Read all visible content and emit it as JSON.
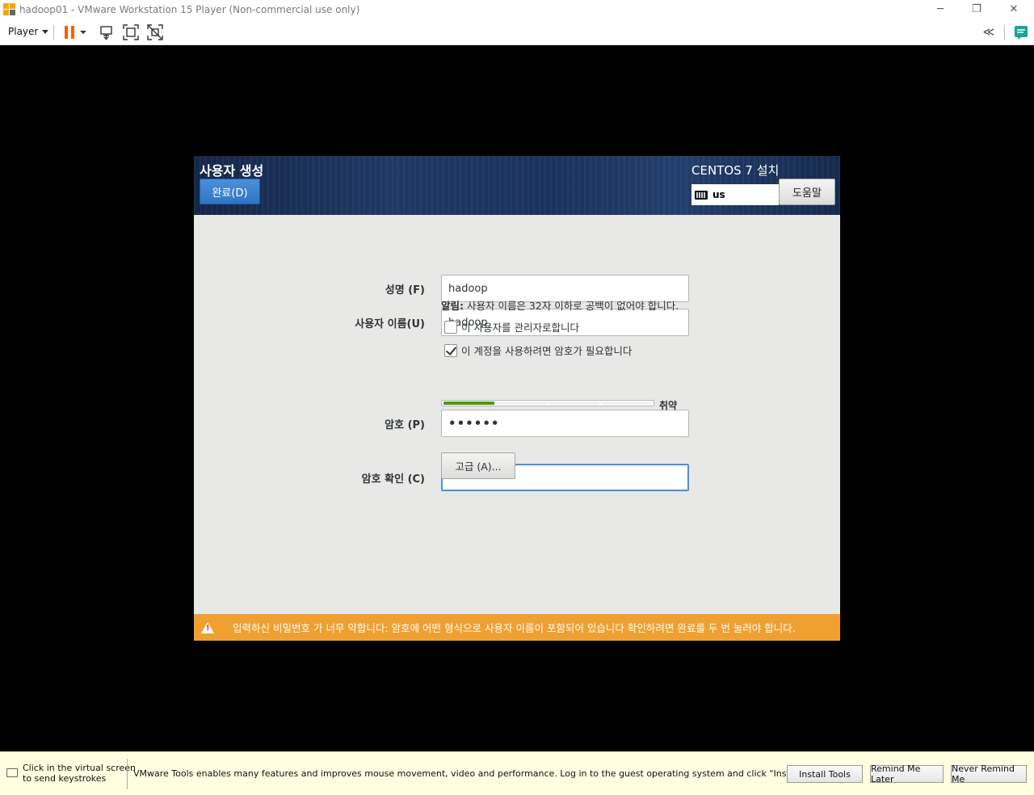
{
  "window": {
    "title": "hadoop01 - VMware Workstation 15 Player (Non-commercial use only)",
    "minimize_glyph": "─",
    "restore_glyph": "❐",
    "close_glyph": "✕"
  },
  "toolbar": {
    "player_menu": "Player",
    "icons": [
      "pause-icon",
      "send-ctrl-alt-del-icon",
      "fullscreen-icon",
      "unity-icon",
      "collapse-icon",
      "message-icon"
    ],
    "collapse_glyph": "≪"
  },
  "colors": {
    "accent_blue": "#2f75c4",
    "warning_orange": "#f0a030",
    "pause_orange": "#e8650a",
    "header_navy": "#1b3461",
    "strength_green": "#4e9a06"
  },
  "installer": {
    "spoke_title": "사용자 생성",
    "done_button": "완료(D)",
    "product_title": "CENTOS 7 설치",
    "keyboard_layout": "us",
    "help_button": "도움말",
    "fields": {
      "fullname_label": "성명 (F)",
      "fullname_value": "hadoop",
      "username_label": "사용자 이름(U)",
      "username_value": "hadoop",
      "password_label": "암호 (P)",
      "password_value": "••••••",
      "confirm_label": "암호 확인 (C)",
      "confirm_value": "••••••"
    },
    "hint_prefix": "알림:",
    "hint_text": " 사용자 이름은 32자 이하로 공백이 없어야 합니다.",
    "admin_checkbox": {
      "label": "이 사용자를 관리자로합니다",
      "checked": false
    },
    "require_password_checkbox": {
      "label": "이 계정을 사용하려면 암호가 필요합니다",
      "checked": true
    },
    "password_strength": {
      "label": "취약",
      "level": 0.25
    },
    "advanced_button": "고급 (A)...",
    "warning": "입력하신 비밀번호 가 너무 약합니다: 암호에 어떤 형식으로 사용자 이름이 포함되어 있습니다  확인하려면 완료를 두 번 눌러야 합니다."
  },
  "bottom_bar": {
    "hint_line1": "Click in the virtual screen",
    "hint_line2": "to send keystrokes",
    "message": "VMware Tools enables many features and improves mouse movement, video and performance. Log in to the guest operating system and click \"Install Tools\".",
    "install_tools": "Install Tools",
    "remind_later": "Remind Me Later",
    "never_remind": "Never Remind Me"
  }
}
